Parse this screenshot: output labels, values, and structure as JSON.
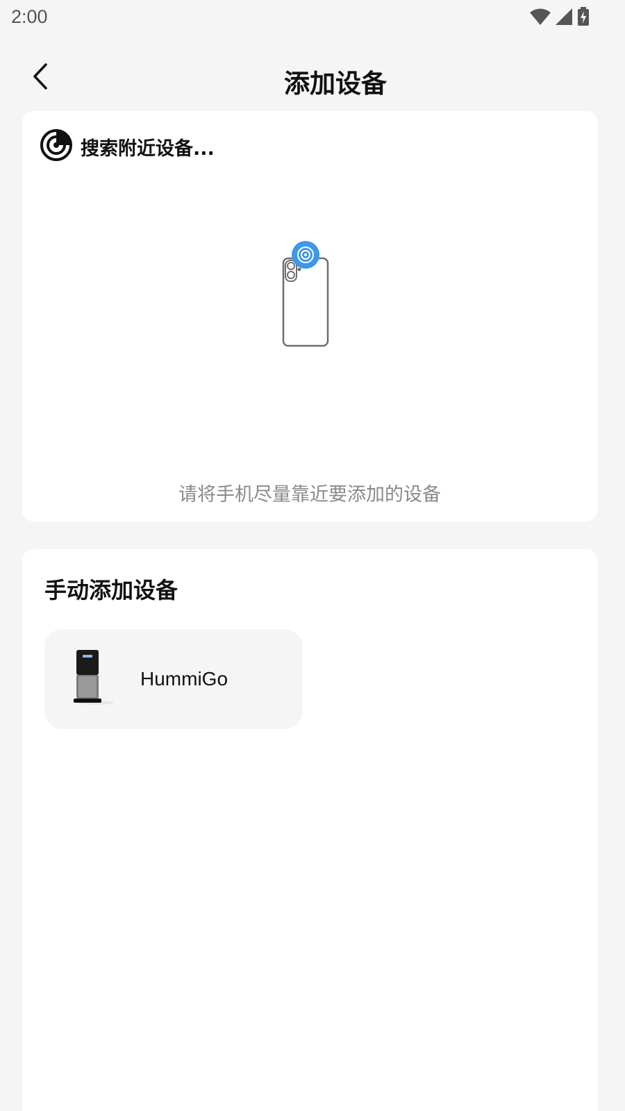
{
  "status_bar": {
    "time": "2:00",
    "icons": [
      "wifi-icon",
      "signal-icon",
      "battery-charging-icon"
    ]
  },
  "header": {
    "title": "添加设备",
    "back_icon": "chevron-left-icon"
  },
  "search_section": {
    "icon": "radar-icon",
    "title": "搜索附近设备...",
    "illustration": "phone-nfc-icon",
    "hint": "请将手机尽量靠近要添加的设备"
  },
  "manual_section": {
    "title": "手动添加设备",
    "devices": [
      {
        "name": "HummiGo",
        "image": "humidifier-device-image"
      }
    ]
  },
  "colors": {
    "background": "#f5f5f5",
    "card": "#ffffff",
    "accent": "#3d97ea",
    "hint_text": "#8a8a8a"
  }
}
